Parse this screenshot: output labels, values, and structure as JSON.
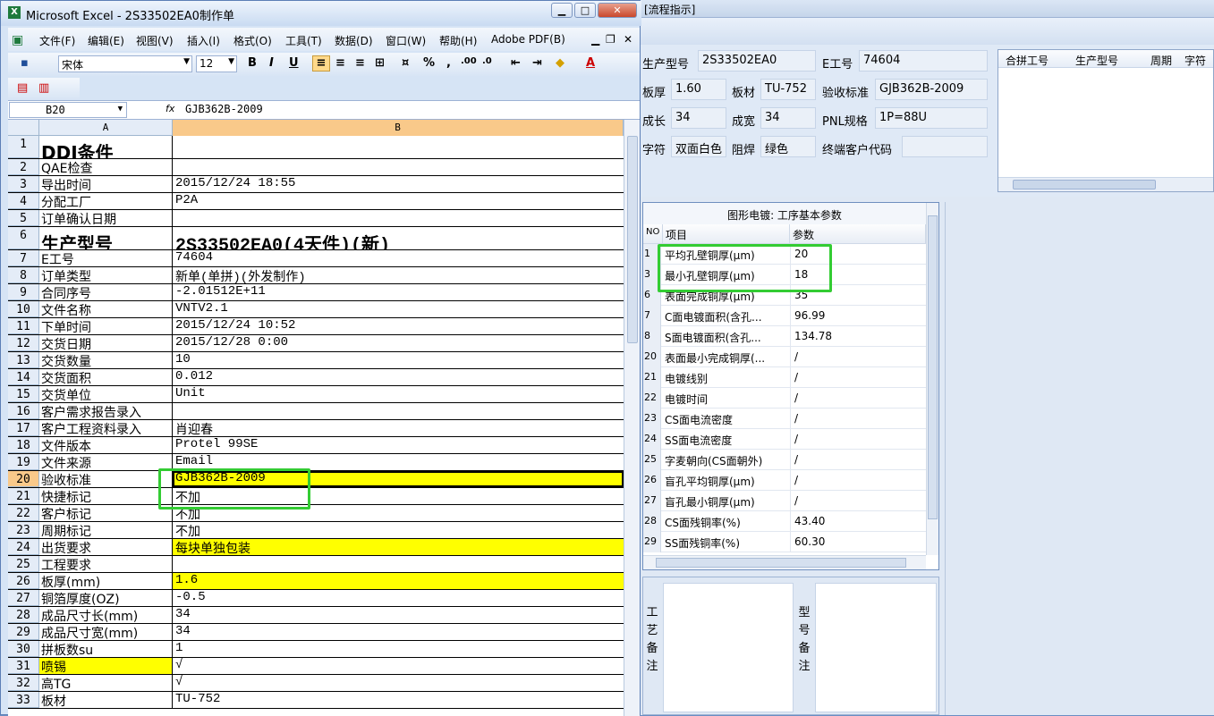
{
  "excel": {
    "window_title": "Microsoft Excel - 2S33502EA0制作单",
    "menu": [
      "文件(F)",
      "编辑(E)",
      "视图(V)",
      "插入(I)",
      "格式(O)",
      "工具(T)",
      "数据(D)",
      "窗口(W)",
      "帮助(H)",
      "Adobe PDF(B)"
    ],
    "font_name": "宋体",
    "font_size": "12",
    "name_box": "B20",
    "fx": "fx",
    "formula": "GJB362B-2009",
    "columns": [
      "A",
      "B"
    ],
    "rows": [
      {
        "n": "1",
        "a": "DDI条件",
        "b": ""
      },
      {
        "n": "2",
        "a": "QAE检查",
        "b": ""
      },
      {
        "n": "3",
        "a": "导出时间",
        "b": "2015/12/24 18:55"
      },
      {
        "n": "4",
        "a": "分配工厂",
        "b": "P2A"
      },
      {
        "n": "5",
        "a": "订单确认日期",
        "b": ""
      },
      {
        "n": "6",
        "a": "生产型号",
        "b": "2S33502EA0(4天件)(新)"
      },
      {
        "n": "7",
        "a": "E工号",
        "b": "74604"
      },
      {
        "n": "8",
        "a": "订单类型",
        "b": "新单(单拼)(外发制作)"
      },
      {
        "n": "9",
        "a": "合同序号",
        "b": "-2.01512E+11"
      },
      {
        "n": "10",
        "a": "文件名称",
        "b": "VNTV2.1"
      },
      {
        "n": "11",
        "a": "下单时间",
        "b": "2015/12/24 10:52"
      },
      {
        "n": "12",
        "a": "交货日期",
        "b": "2015/12/28 0:00"
      },
      {
        "n": "13",
        "a": "交货数量",
        "b": "10"
      },
      {
        "n": "14",
        "a": "交货面积",
        "b": "0.012"
      },
      {
        "n": "15",
        "a": "交货单位",
        "b": "Unit"
      },
      {
        "n": "16",
        "a": "客户需求报告录入",
        "b": ""
      },
      {
        "n": "17",
        "a": "客户工程资料录入",
        "b": "肖迎春"
      },
      {
        "n": "18",
        "a": "文件版本",
        "b": "Protel 99SE"
      },
      {
        "n": "19",
        "a": "文件来源",
        "b": "Email"
      },
      {
        "n": "20",
        "a": "验收标准",
        "b": "GJB362B-2009"
      },
      {
        "n": "21",
        "a": "快捷标记",
        "b": "不加"
      },
      {
        "n": "22",
        "a": "客户标记",
        "b": "不加"
      },
      {
        "n": "23",
        "a": "周期标记",
        "b": "不加"
      },
      {
        "n": "24",
        "a": "出货要求",
        "b": "每块单独包装"
      },
      {
        "n": "25",
        "a": "工程要求",
        "b": ""
      },
      {
        "n": "26",
        "a": "板厚(mm)",
        "b": "1.6"
      },
      {
        "n": "27",
        "a": "铜箔厚度(OZ)",
        "b": "-0.5"
      },
      {
        "n": "28",
        "a": "成品尺寸长(mm)",
        "b": "34"
      },
      {
        "n": "29",
        "a": "成品尺寸宽(mm)",
        "b": "34"
      },
      {
        "n": "30",
        "a": "拼板数su",
        "b": "1"
      },
      {
        "n": "31",
        "a": "喷锡",
        "b": "√"
      },
      {
        "n": "32",
        "a": "高TG",
        "b": "√"
      },
      {
        "n": "33",
        "a": "板材",
        "b": "TU-752"
      }
    ],
    "highlight_color": "#ffff00"
  },
  "app": {
    "title": "[流程指示]",
    "fields": {
      "model_label": "生产型号",
      "model_value": "2S33502EA0",
      "eno_label": "E工号",
      "eno_value": "74604",
      "thick_label": "板厚",
      "thick_value": "1.60",
      "material_label": "板材",
      "material_value": "TU-752",
      "std_label": "验收标准",
      "std_value": "GJB362B-2009",
      "len_label": "成长",
      "len_value": "34",
      "width_label": "成宽",
      "width_value": "34",
      "pnl_label": "PNL规格",
      "pnl_value": "1P=88U",
      "char_label": "字符",
      "char_value": "双面白色",
      "mask_label": "阻焊",
      "mask_value": "绿色",
      "cust_label": "终端客户代码",
      "cust_value": ""
    },
    "merge_table": {
      "headers": [
        "合拼工号",
        "生产型号",
        "周期",
        "字符"
      ]
    },
    "param_grid": {
      "caption": "图形电镀: 工序基本参数",
      "headers": [
        "NO",
        "项目",
        "参数"
      ],
      "rows": [
        {
          "no": "1",
          "item": "平均孔壁铜厚(μm)",
          "val": "20"
        },
        {
          "no": "3",
          "item": "最小孔壁铜厚(μm)",
          "val": "18"
        },
        {
          "no": "6",
          "item": "表面完成铜厚(μm)",
          "val": "35"
        },
        {
          "no": "7",
          "item": "C面电镀面积(含孔...",
          "val": "96.99"
        },
        {
          "no": "8",
          "item": "S面电镀面积(含孔...",
          "val": "134.78"
        },
        {
          "no": "20",
          "item": "表面最小完成铜厚(...",
          "val": "/"
        },
        {
          "no": "21",
          "item": "电镀线别",
          "val": "/"
        },
        {
          "no": "22",
          "item": "电镀时间",
          "val": "/"
        },
        {
          "no": "23",
          "item": "CS面电流密度",
          "val": "/"
        },
        {
          "no": "24",
          "item": "SS面电流密度",
          "val": "/"
        },
        {
          "no": "25",
          "item": "字麦朝向(CS面朝外)",
          "val": "/"
        },
        {
          "no": "26",
          "item": "盲孔平均铜厚(μm)",
          "val": "/"
        },
        {
          "no": "27",
          "item": "盲孔最小铜厚(μm)",
          "val": "/"
        },
        {
          "no": "28",
          "item": "CS面残铜率(%)",
          "val": "43.40"
        },
        {
          "no": "29",
          "item": "SS面残铜率(%)",
          "val": "60.30"
        }
      ]
    },
    "notes": {
      "process_label": "工艺备注",
      "model_label": "型号备注"
    },
    "highlight_box_color": "#33cc33"
  }
}
